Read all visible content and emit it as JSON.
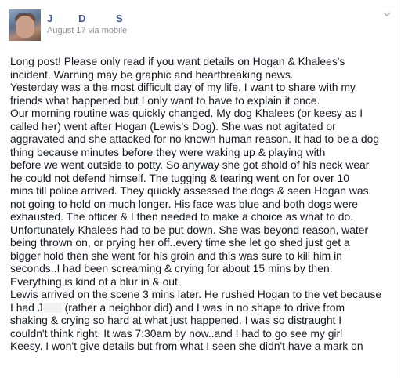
{
  "post": {
    "author_initials": [
      "J",
      "D",
      "S"
    ],
    "date": "August 17",
    "via": "via mobile",
    "lines": [
      "Long post! Please only read if you want details on Hogan & Khalees's",
      "incident. Warning may be graphic and heartbreaking news.",
      "Yesterday was a the most difficult day of my life. I want to share with my",
      "friends what happened but I only want to have to explain it once.",
      "Our morning routine was quickly changed. My dog Khalees (or keesy as I",
      "called her) went after Hogan (Lewis's Dog). She was not agitated or",
      "aggravated and she attacked for no known human reason. It had to be a dog",
      "thing because minutes before they were waking up & playing with",
      "before we went outside to potty. So anyway she got ahold of his neck wear",
      "he could not defend himself. The tugging & tearing went on for over 10",
      "mins till police arrived. They quickly assessed the dogs & seen Hogan was",
      "not going to hold on much longer. His face was blue and both dogs were",
      "exhausted. The officer & I then needed to make a choice as what to do.",
      "Unfortunately Khalees had to be put down. She was beyond reason, water",
      "being thrown on, or prying her off..every time she let go shed just get a",
      "bigger hold then she went for his groin and this was sure to kill him in",
      "seconds..I had been screaming & crying for about 15 mins by then.",
      "Everything is kind of a blur in & out.",
      "Lewis arrived on the scene 3 mins later. He rushed Hogan to the vet because",
      "I had J",
      "(rather a neighbor did) and I was in no shape to drive from",
      "shaking & crying so hard at what just happened. I was so distraught I",
      "couldn't think right. It was 7:30am by now..and I had to go see my girl",
      "Keesy. I won't give details but from what I seen she didn't have a mark on"
    ]
  },
  "icons": {
    "menu": "chevron-down-icon",
    "avatar": "profile-photo"
  },
  "colors": {
    "name": "#3b5998",
    "meta": "#90949c",
    "text": "#141823"
  }
}
